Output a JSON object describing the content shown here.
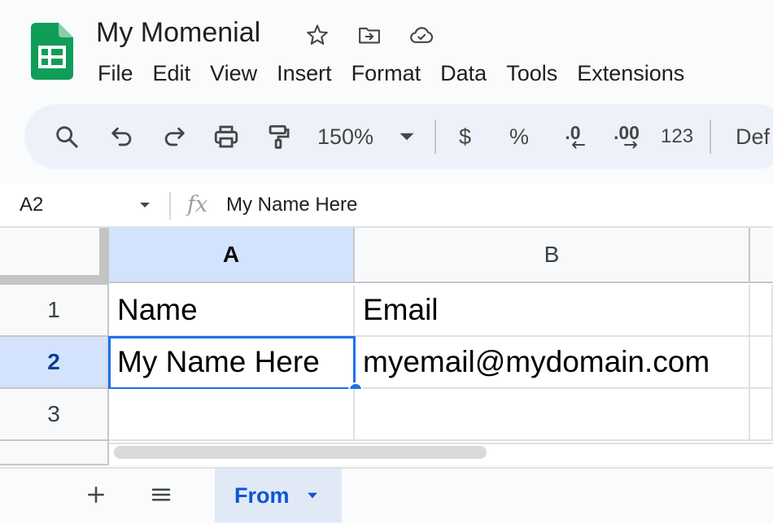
{
  "app": {
    "title": "My Momenial",
    "colors": {
      "brand_green": "#0f9d58",
      "accent_blue": "#1a73e8",
      "selected_header": "#d3e3fd",
      "toolbar_bg": "#edf2fa"
    }
  },
  "title_icons": [
    "star-icon",
    "move-to-folder-icon",
    "cloud-saved-icon"
  ],
  "menu": [
    "File",
    "Edit",
    "View",
    "Insert",
    "Format",
    "Data",
    "Tools",
    "Extensions"
  ],
  "toolbar": {
    "icons": [
      "search-icon",
      "undo-icon",
      "redo-icon",
      "print-icon",
      "paint-format-icon",
      "chevron-down-icon"
    ],
    "zoom": "150%",
    "currency": "$",
    "percent": "%",
    "decrease_decimals": ".0",
    "increase_decimals": ".00",
    "number_format": "123",
    "font": "Def"
  },
  "formula_bar": {
    "name_box": "A2",
    "fx": "fx",
    "value": "My Name Here"
  },
  "grid": {
    "columns": [
      "A",
      "B"
    ],
    "rows": [
      "1",
      "2",
      "3"
    ],
    "cells": [
      [
        "Name",
        "Email"
      ],
      [
        "My Name Here",
        "myemail@mydomain.com"
      ],
      [
        "",
        ""
      ]
    ],
    "active_cell": "A2"
  },
  "sheets": {
    "tab_icons": [
      "add-sheet-icon",
      "all-sheets-menu-icon"
    ],
    "active": "From"
  }
}
